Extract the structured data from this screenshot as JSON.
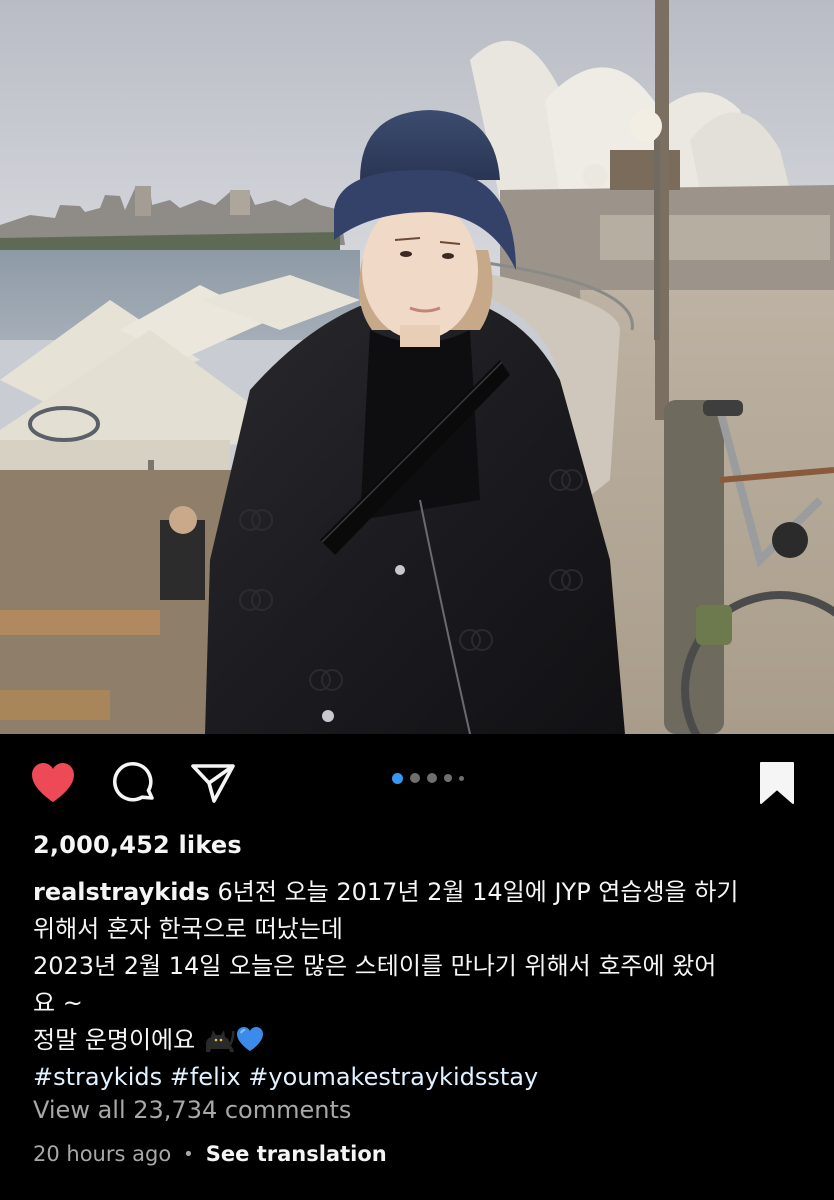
{
  "post": {
    "image_alt": "Photo at Sydney Opera House",
    "carousel": {
      "total": 5,
      "current": 1
    },
    "liked": true,
    "saved": true
  },
  "actions": {
    "like_icon": "heart-filled-icon",
    "comment_icon": "comment-bubble-icon",
    "share_icon": "paper-plane-icon",
    "save_icon": "bookmark-filled-icon"
  },
  "likes_text": "2,000,452 likes",
  "caption": {
    "username": "realstraykids",
    "line1_rest": "6년전 오늘 2017년 2월 14일에 JYP 연습생을 하기",
    "line2": "위해서 혼자 한국으로 떠났는데",
    "line3": "2023년 2월 14일 오늘은 많은 스테이를 만나기 위해서 호주에 왔어",
    "line4": "요 ~",
    "line5": "정말 운명이에요",
    "line5_emojis": [
      "black-cat-emoji",
      "blue-heart-emoji"
    ],
    "hashtags": [
      "#straykids",
      "#felix",
      "#youmakestraykidsstay"
    ]
  },
  "comments_link": "View all 23,734 comments",
  "timestamp": "20 hours ago",
  "separator": "•",
  "translate_label": "See translation",
  "colors": {
    "background": "#000000",
    "like_red": "#ed4956",
    "carousel_active": "#3897f0",
    "secondary_text": "#a8a8a8",
    "hashtag": "#e0f1ff"
  }
}
